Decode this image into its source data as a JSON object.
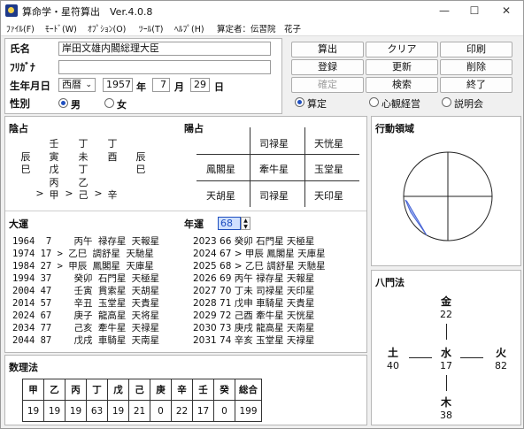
{
  "window": {
    "title": "算命学・星符算出　Ver.4.0.8",
    "controls": [
      "—",
      "☐",
      "✕"
    ]
  },
  "menu": [
    "ﾌｧｲﾙ(F)",
    "ﾓｰﾄﾞ(W)",
    "ｵﾌﾟｼｮﾝ(O)",
    "ﾂｰﾙ(T)",
    "ﾍﾙﾌﾟ(H)",
    "算定者：伝習院　花子"
  ],
  "profile": {
    "name_label": "氏名",
    "name_value": "岸田文雄内閣総理大臣",
    "kana_label": "ﾌﾘｶﾞﾅ",
    "kana_value": "",
    "birth_label": "生年月日",
    "era": "西暦",
    "year": "1957",
    "year_unit": "年",
    "month": "7",
    "month_unit": "月",
    "day": "29",
    "day_unit": "日",
    "gender_label": "性別",
    "male": "男",
    "female": "女"
  },
  "buttons": {
    "calc": "算出",
    "clear": "クリア",
    "print": "印刷",
    "register": "登録",
    "update": "更新",
    "delete": "削除",
    "confirm": "確定",
    "search": "検索",
    "exit": "終了"
  },
  "modes": {
    "a": "算定",
    "b": "心観経営",
    "c": "説明会"
  },
  "inyo": {
    "title": "陰占",
    "rows": [
      [
        "",
        "壬",
        "丁",
        "丁",
        ""
      ],
      [
        "辰",
        "寅",
        "未",
        "酉",
        "辰"
      ],
      [
        "巳",
        "戊",
        "丁",
        "",
        "巳"
      ],
      [
        "",
        "丙",
        "乙",
        "",
        ""
      ]
    ],
    "chain": [
      ">",
      "甲",
      ">",
      "己",
      ">",
      "辛"
    ]
  },
  "yosen": {
    "title": "陽占",
    "grid": [
      [
        "",
        "司禄星",
        "天恍星"
      ],
      [
        "鳳閣星",
        "牽牛星",
        "玉堂星"
      ],
      [
        "天胡星",
        "司禄星",
        "天印星"
      ]
    ]
  },
  "area": {
    "title": "行動領域"
  },
  "taiun": {
    "title": "大運",
    "rows": [
      "1964  7    丙午 禄存星 天報星",
      "1974 17 > 乙巳 調舒星 天馳星",
      "1984 27 > 甲辰 鳳閣星 天庫星",
      "1994 37    癸卯 石門星 天極星",
      "2004 47    壬寅 貫索星 天胡星",
      "2014 57    辛丑 玉堂星 天貴星",
      "2024 67    庚子 龍高星 天将星",
      "2034 77    己亥 牽牛星 天禄星",
      "2044 87    戊戌 車騎星 天南星"
    ]
  },
  "nenun": {
    "title": "年運",
    "spin_value": "68",
    "rows": [
      "2023  66    癸卯 石門星 天極星",
      "2024  67 >  甲辰 鳳閣星 天庫星",
      "2025  68 >  乙巳 調舒星 天馳星",
      "2026  69    丙午 禄存星 天報星",
      "2027  70    丁未 司禄星 天印星",
      "2028  71    戊申 車騎星 天貴星",
      "2029  72    己酉 牽牛星 天恍星",
      "2030  73    庚戌 龍高星 天南星",
      "2031  74    辛亥 玉堂星 天禄星"
    ]
  },
  "suri": {
    "title": "数理法",
    "headers": [
      "甲",
      "乙",
      "丙",
      "丁",
      "戊",
      "己",
      "庚",
      "辛",
      "壬",
      "癸",
      "総合"
    ],
    "values": [
      "19",
      "19",
      "19",
      "63",
      "19",
      "21",
      "0",
      "22",
      "17",
      "0",
      "199"
    ]
  },
  "hachimon": {
    "title": "八門法",
    "north": {
      "label": "金",
      "value": "22"
    },
    "west": {
      "label": "土",
      "value": "40"
    },
    "center": {
      "label": "水",
      "value": "17"
    },
    "east": {
      "label": "火",
      "value": "82"
    },
    "south": {
      "label": "木",
      "value": "38"
    }
  }
}
